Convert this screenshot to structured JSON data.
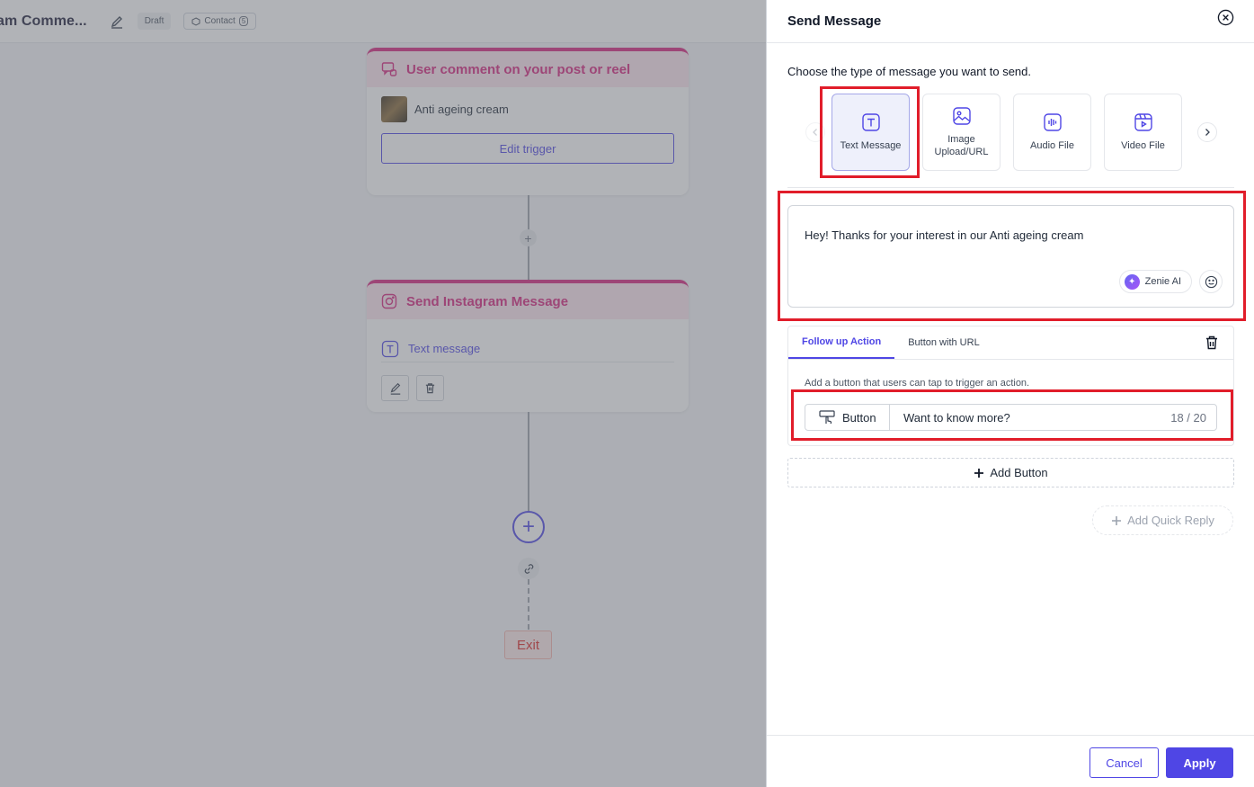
{
  "canvas": {
    "flow_title": "am Comme...",
    "draft_badge": "Draft",
    "contact_badge": "Contact",
    "contact_count": "5",
    "trigger_card": {
      "title": "User comment on your post or reel",
      "product_name": "Anti ageing cream",
      "edit_label": "Edit trigger"
    },
    "message_card": {
      "title": "Send Instagram Message",
      "type_label": "Text message"
    },
    "add_symbol": "+",
    "exit_label": "Exit"
  },
  "drawer": {
    "title": "Send Message",
    "choose_label": "Choose the type of message you want to send.",
    "types": [
      {
        "label": "Text Message",
        "icon": "text-type-icon",
        "selected": true
      },
      {
        "label": "Image Upload/URL",
        "icon": "image-icon",
        "selected": false
      },
      {
        "label": "Audio File",
        "icon": "audio-icon",
        "selected": false
      },
      {
        "label": "Video File",
        "icon": "video-icon",
        "selected": false
      }
    ],
    "message_text": "Hey! Thanks for your interest in our Anti ageing cream",
    "zenie_label": "Zenie AI",
    "tabs": [
      {
        "label": "Follow up Action",
        "active": true
      },
      {
        "label": "Button with URL",
        "active": false
      }
    ],
    "helper_text": "Add a button that users can tap to trigger an action.",
    "button_type_label": "Button",
    "button_text_value": "Want to know more?",
    "button_counter": "18 / 20",
    "add_button_label": "Add Button",
    "add_quick_reply_label": "Add Quick Reply",
    "cancel_label": "Cancel",
    "apply_label": "Apply"
  },
  "colors": {
    "accent": "#4f46e5",
    "trigger_pink": "#d6257e",
    "highlight_red": "#e11d2a",
    "exit_red": "#dc2626"
  }
}
